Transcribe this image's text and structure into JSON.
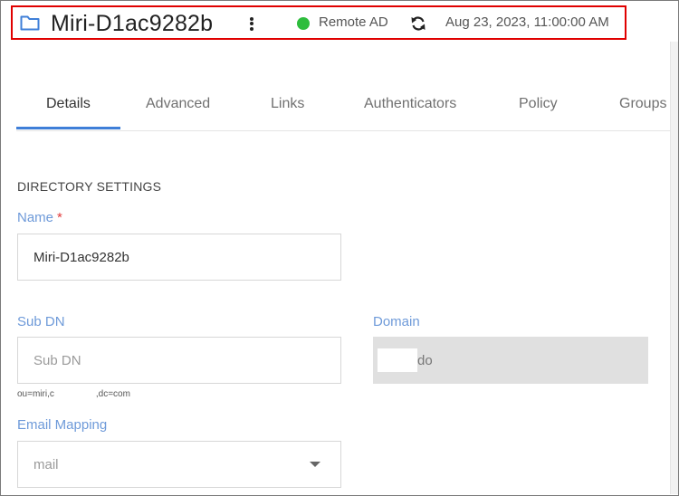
{
  "header": {
    "title": "Miri-D1ac9282b",
    "status": {
      "label": "Remote AD",
      "color": "#2ebd3d"
    },
    "sync_time": "Aug 23, 2023, 11:00:00 AM",
    "accent": "#e00000",
    "icons": {
      "folder": "folder-icon",
      "more": "kebab-menu-icon",
      "sync": "sync-icon"
    }
  },
  "tabs": [
    {
      "label": "Details",
      "active": true
    },
    {
      "label": "Advanced",
      "active": false
    },
    {
      "label": "Links",
      "active": false
    },
    {
      "label": "Authenticators",
      "active": false
    },
    {
      "label": "Policy",
      "active": false
    },
    {
      "label": "Groups",
      "active": false
    }
  ],
  "form": {
    "section_title": "DIRECTORY SETTINGS",
    "name": {
      "label": "Name",
      "required_marker": "*",
      "value": "Miri-D1ac9282b"
    },
    "sub_dn": {
      "label": "Sub DN",
      "placeholder": "Sub DN",
      "hint_prefix": "ou=miri,c",
      "hint_suffix": ",dc=com"
    },
    "domain": {
      "label": "Domain",
      "value_suffix": "do"
    },
    "email_mapping": {
      "label": "Email Mapping",
      "value": "mail"
    }
  },
  "colors": {
    "tab_active_underline": "#3f7fd8",
    "label": "#6e9ad9",
    "required": "#e23b3b"
  }
}
